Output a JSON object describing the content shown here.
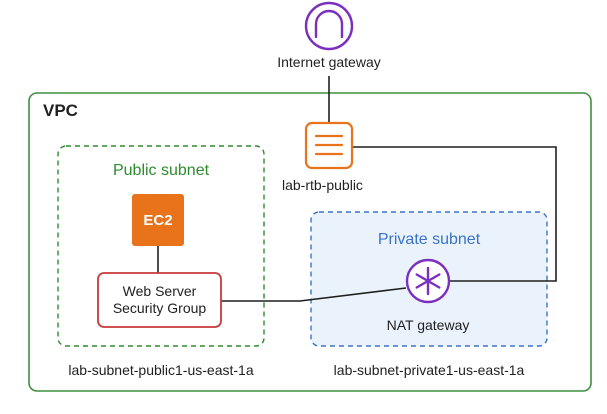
{
  "internet_gateway": {
    "label": "Internet gateway"
  },
  "vpc": {
    "label": "VPC"
  },
  "route_table": {
    "label": "lab-rtb-public"
  },
  "public_subnet": {
    "label": "Public subnet",
    "name": "lab-subnet-public1-us-east-1a"
  },
  "ec2": {
    "label": "EC2"
  },
  "security_group": {
    "line1": "Web Server",
    "line2": "Security Group"
  },
  "private_subnet": {
    "label": "Private subnet",
    "name": "lab-subnet-private1-us-east-1a"
  },
  "nat_gateway": {
    "label": "NAT gateway"
  },
  "colors": {
    "vpc_border": "#3f8f3f",
    "public_subnet": "#2e8b2e",
    "private_subnet": "#3a73c9",
    "private_fill": "#eaf3fc",
    "gateway_purple": "#7b2fbf",
    "aws_orange": "#e8731a",
    "sg_red": "#c83a3a"
  },
  "icons": {
    "internet_gateway": "internet-gateway-icon",
    "route_table": "route-table-icon",
    "ec2": "ec2-icon",
    "nat_gateway": "nat-gateway-icon"
  }
}
